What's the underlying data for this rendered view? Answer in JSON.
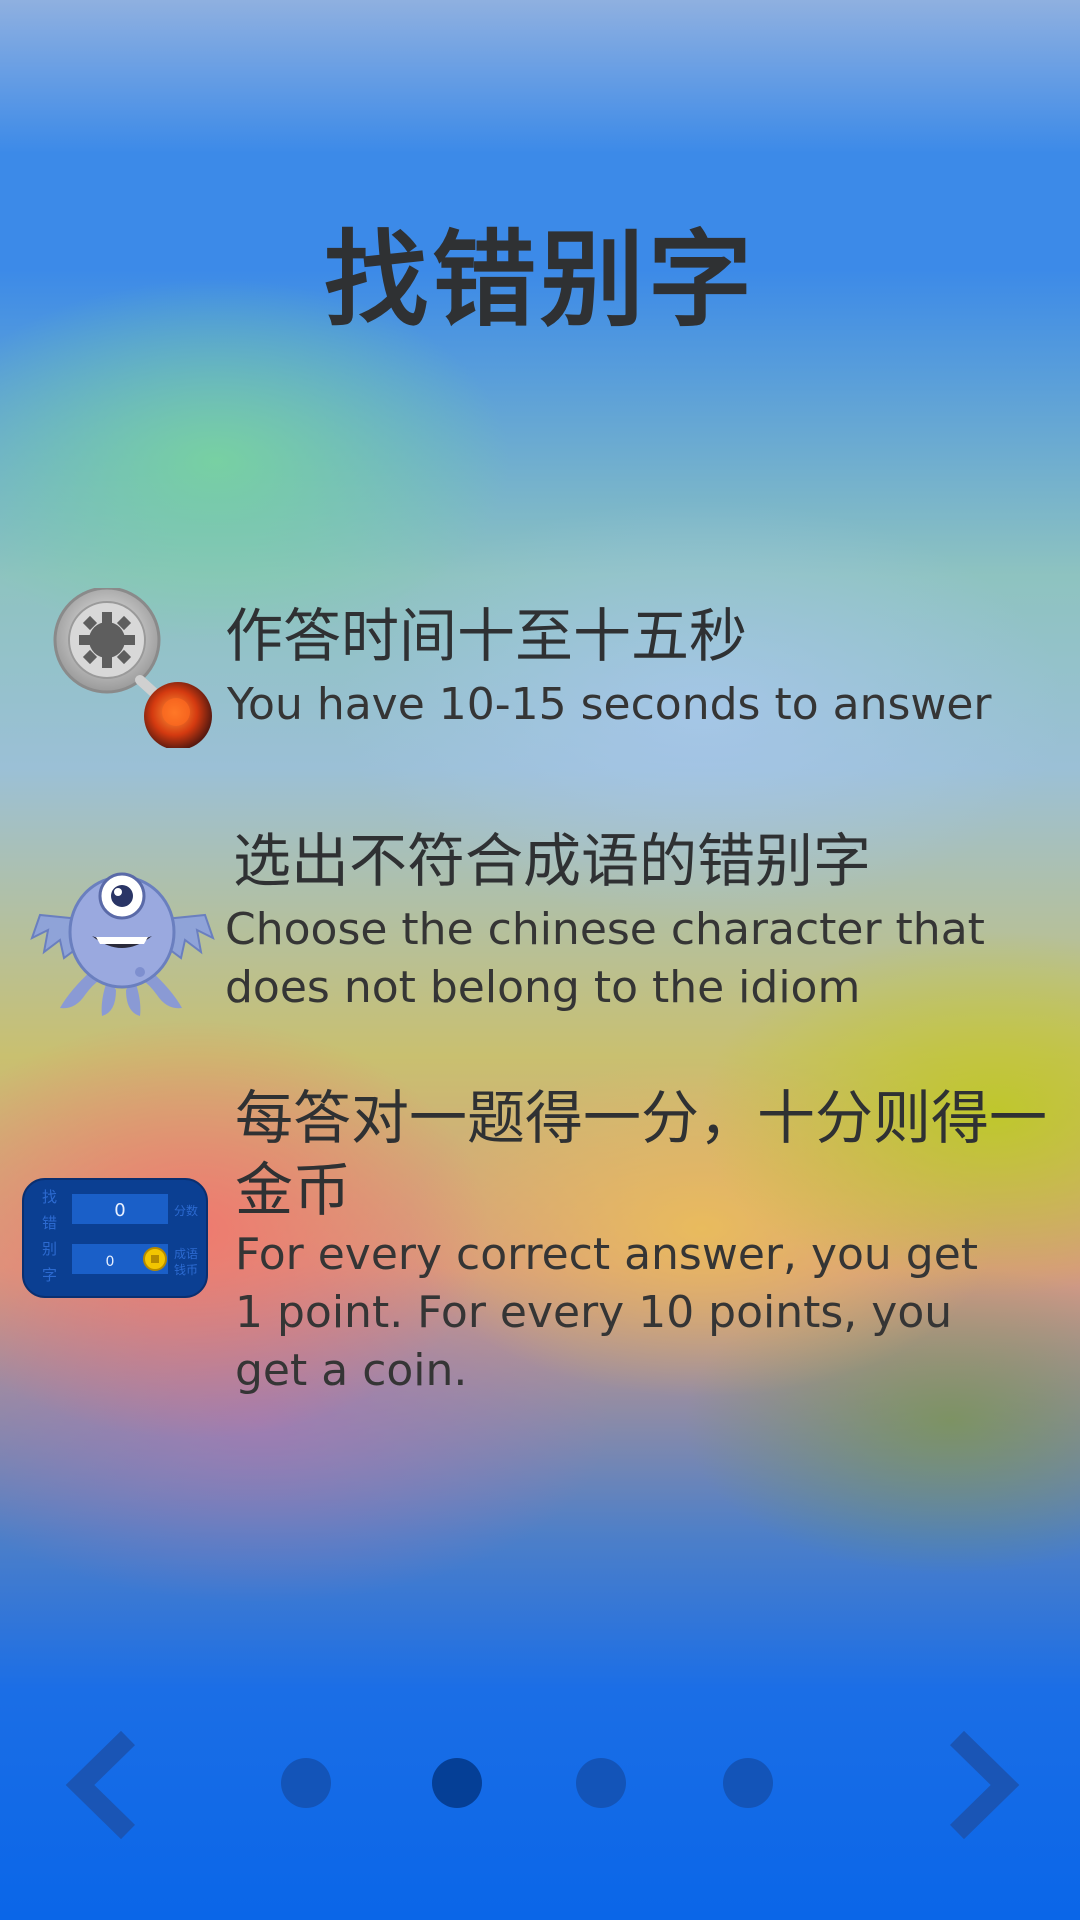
{
  "app": {
    "title": "找错别字"
  },
  "rules": [
    {
      "icon": "timer-fuse-icon",
      "zh": "作答时间十至十五秒",
      "en": "You have 10-15 seconds to answer"
    },
    {
      "icon": "one-eyed-monster-icon",
      "zh": "选出不符合成语的错别字",
      "en": "Choose the chinese character that does not belong to the idiom"
    },
    {
      "icon": "scoreboard-icon",
      "zh": "每答对一题得一分，十分则得一金币",
      "en": "For every correct answer, you get 1 point. For every 10 points, you get a coin."
    }
  ],
  "scoreboard": {
    "side_label": "找错别字",
    "score_value": "0",
    "coin_value": "0",
    "score_label": "分数",
    "coin_label": "成语钱币"
  },
  "pager": {
    "total": 4,
    "active_index": 1,
    "prev_icon": "chevron-left-icon",
    "next_icon": "chevron-right-icon"
  },
  "colors": {
    "text": "#2f3133",
    "nav": "#1354b8",
    "dot_active": "#053f96"
  }
}
